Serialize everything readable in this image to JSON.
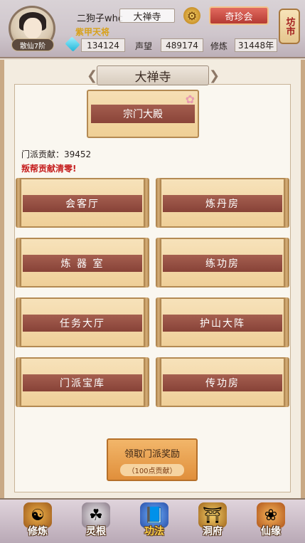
{
  "header": {
    "player_name": "二狗子whc",
    "sect_name": "大禅寺",
    "title": "紫甲天将",
    "rank": "散仙7阶",
    "treasure_label": "奇珍会",
    "market_label": "坊市",
    "gems": "134124",
    "reputation_label": "声望",
    "reputation": "489174",
    "cultivation_label": "修炼",
    "cultivation": "31448年"
  },
  "panel": {
    "title": "大禅寺",
    "main_hall": "宗门大殿",
    "contribution": "门派贡献：39452",
    "warning": "叛帮贡献清零!",
    "rooms": [
      {
        "label": "会客厅"
      },
      {
        "label": "炼丹房"
      },
      {
        "label": "炼 器 室"
      },
      {
        "label": "练功房"
      },
      {
        "label": "任务大厅"
      },
      {
        "label": "护山大阵"
      },
      {
        "label": "门派宝库"
      },
      {
        "label": "传功房"
      }
    ],
    "reward_label": "领取门派奖励",
    "reward_cost": "（100点贡献）"
  },
  "nav": {
    "items": [
      {
        "label": "修炼",
        "icon": "cultivate-icon"
      },
      {
        "label": "灵根",
        "icon": "spirit-root-icon"
      },
      {
        "label": "功法",
        "icon": "technique-icon"
      },
      {
        "label": "洞府",
        "icon": "cave-icon"
      },
      {
        "label": "仙缘",
        "icon": "fate-icon"
      }
    ],
    "active_index": 2
  }
}
